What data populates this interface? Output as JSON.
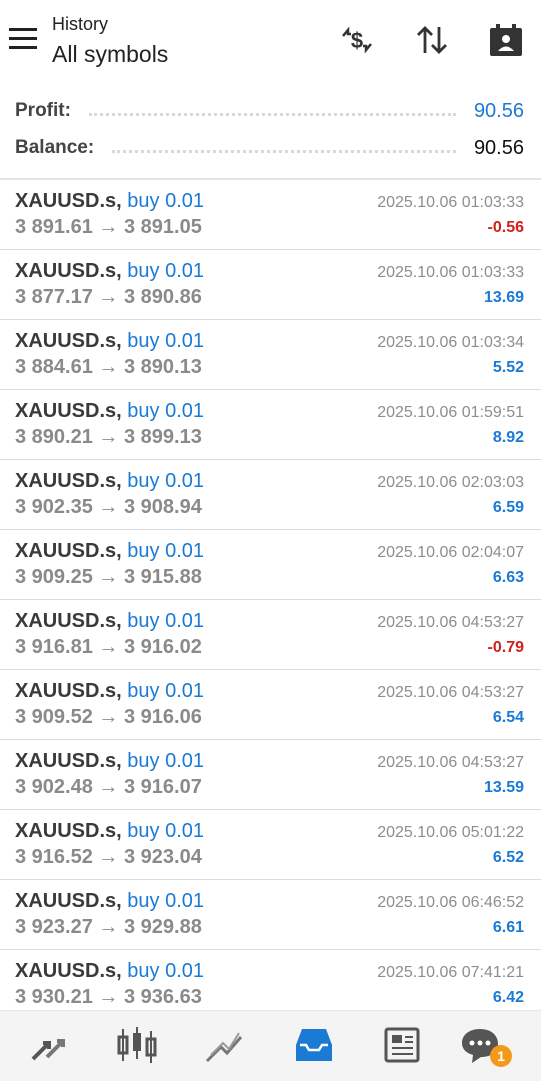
{
  "header": {
    "subtitle": "History",
    "title": "All symbols"
  },
  "summary": {
    "profit_label": "Profit:",
    "profit_value": "90.56",
    "balance_label": "Balance:",
    "balance_value": "90.56"
  },
  "colors": {
    "accent": "#1a7ad4",
    "negative": "#d0211c",
    "badge": "#f39a1b"
  },
  "deals": [
    {
      "symbol": "XAUUSD.s,",
      "side": "buy 0.01",
      "open": "3 891.61",
      "close": "3 891.05",
      "arrow": "→",
      "time": "2025.10.06 01:03:33",
      "profit": "-0.56",
      "negative": true
    },
    {
      "symbol": "XAUUSD.s,",
      "side": "buy 0.01",
      "open": "3 877.17",
      "close": "3 890.86",
      "arrow": "→",
      "time": "2025.10.06 01:03:33",
      "profit": "13.69",
      "negative": false
    },
    {
      "symbol": "XAUUSD.s,",
      "side": "buy 0.01",
      "open": "3 884.61",
      "close": "3 890.13",
      "arrow": "→",
      "time": "2025.10.06 01:03:34",
      "profit": "5.52",
      "negative": false
    },
    {
      "symbol": "XAUUSD.s,",
      "side": "buy 0.01",
      "open": "3 890.21",
      "close": "3 899.13",
      "arrow": "→",
      "time": "2025.10.06 01:59:51",
      "profit": "8.92",
      "negative": false
    },
    {
      "symbol": "XAUUSD.s,",
      "side": "buy 0.01",
      "open": "3 902.35",
      "close": "3 908.94",
      "arrow": "→",
      "time": "2025.10.06 02:03:03",
      "profit": "6.59",
      "negative": false
    },
    {
      "symbol": "XAUUSD.s,",
      "side": "buy 0.01",
      "open": "3 909.25",
      "close": "3 915.88",
      "arrow": "→",
      "time": "2025.10.06 02:04:07",
      "profit": "6.63",
      "negative": false
    },
    {
      "symbol": "XAUUSD.s,",
      "side": "buy 0.01",
      "open": "3 916.81",
      "close": "3 916.02",
      "arrow": "→",
      "time": "2025.10.06 04:53:27",
      "profit": "-0.79",
      "negative": true
    },
    {
      "symbol": "XAUUSD.s,",
      "side": "buy 0.01",
      "open": "3 909.52",
      "close": "3 916.06",
      "arrow": "→",
      "time": "2025.10.06 04:53:27",
      "profit": "6.54",
      "negative": false
    },
    {
      "symbol": "XAUUSD.s,",
      "side": "buy 0.01",
      "open": "3 902.48",
      "close": "3 916.07",
      "arrow": "→",
      "time": "2025.10.06 04:53:27",
      "profit": "13.59",
      "negative": false
    },
    {
      "symbol": "XAUUSD.s,",
      "side": "buy 0.01",
      "open": "3 916.52",
      "close": "3 923.04",
      "arrow": "→",
      "time": "2025.10.06 05:01:22",
      "profit": "6.52",
      "negative": false
    },
    {
      "symbol": "XAUUSD.s,",
      "side": "buy 0.01",
      "open": "3 923.27",
      "close": "3 929.88",
      "arrow": "→",
      "time": "2025.10.06 06:46:52",
      "profit": "6.61",
      "negative": false
    },
    {
      "symbol": "XAUUSD.s,",
      "side": "buy 0.01",
      "open": "3 930.21",
      "close": "3 936.63",
      "arrow": "→",
      "time": "2025.10.06 07:41:21",
      "profit": "6.42",
      "negative": false
    }
  ],
  "bottom_nav": {
    "items": [
      {
        "icon": "quotes-arrows-icon"
      },
      {
        "icon": "candlestick-chart-icon"
      },
      {
        "icon": "trend-chart-icon"
      },
      {
        "icon": "history-tray-icon",
        "active": true
      },
      {
        "icon": "news-icon"
      },
      {
        "icon": "messages-icon",
        "badge": "1"
      }
    ]
  }
}
